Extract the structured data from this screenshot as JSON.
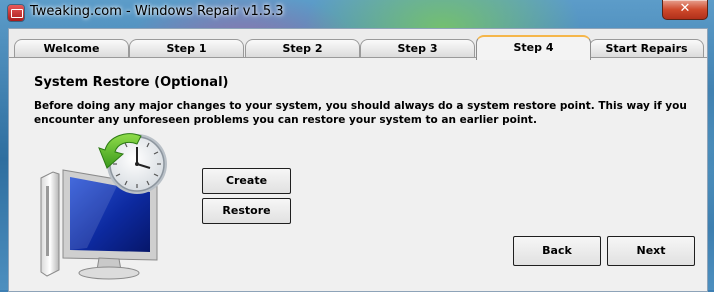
{
  "window": {
    "title": "Tweaking.com - Windows Repair v1.5.3",
    "close_glyph": "✕"
  },
  "tabs": [
    {
      "label": "Welcome",
      "active": false
    },
    {
      "label": "Step 1",
      "active": false
    },
    {
      "label": "Step 2",
      "active": false
    },
    {
      "label": "Step 3",
      "active": false
    },
    {
      "label": "Step 4",
      "active": true
    },
    {
      "label": "Start Repairs",
      "active": false
    }
  ],
  "content": {
    "heading": "System Restore (Optional)",
    "description": "Before doing any major changes to your system, you should always do a system restore point. This way if you encounter any unforeseen problems you can restore your system to an earlier point.",
    "illustration_icon": "system-restore-icon"
  },
  "buttons": {
    "create": "Create",
    "restore": "Restore",
    "back": "Back",
    "next": "Next"
  },
  "colors": {
    "active_tab_accent": "#f5b64a",
    "arrow_green": "#4fa823"
  }
}
